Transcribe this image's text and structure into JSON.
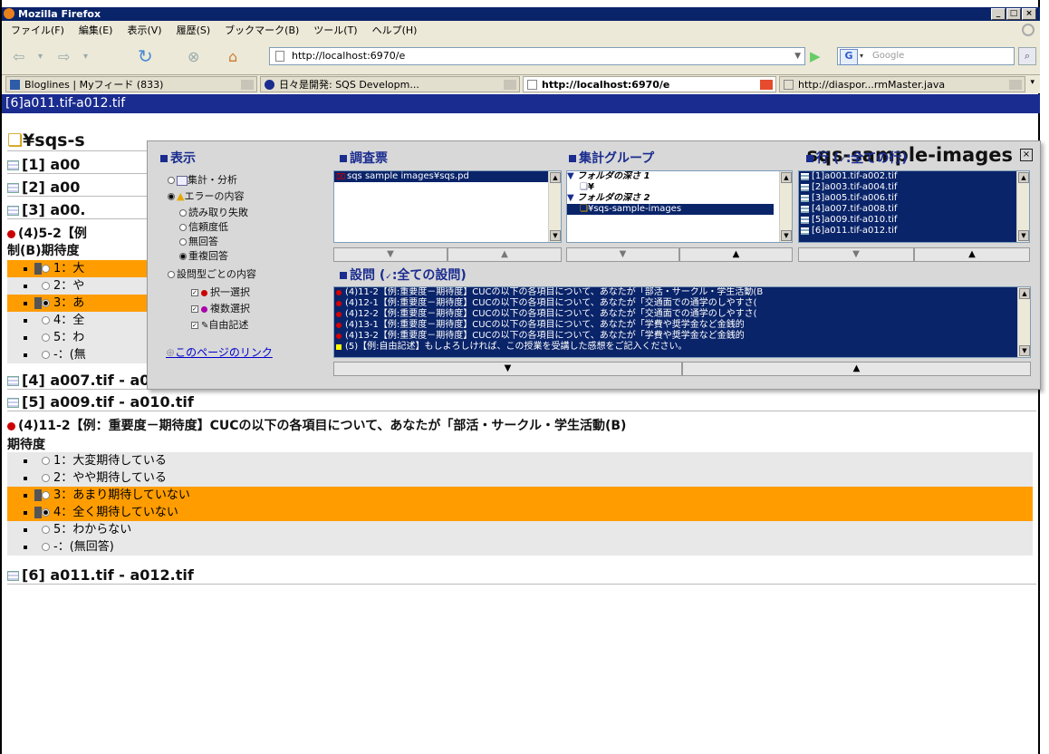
{
  "window": {
    "title": "Mozilla Firefox",
    "min": "_",
    "max": "□",
    "close": "×"
  },
  "menu": [
    "ファイル(F)",
    "編集(E)",
    "表示(V)",
    "履歴(S)",
    "ブックマーク(B)",
    "ツール(T)",
    "ヘルプ(H)"
  ],
  "nav": {
    "url": "http://localhost:6970/e",
    "search_placeholder": "Google"
  },
  "tabs": [
    {
      "label": "Bloglines | Myフィード (833)"
    },
    {
      "label": "日々是開発: SQS Developm..."
    },
    {
      "label": "http://localhost:6970/e"
    },
    {
      "label": "http://diaspor...rmMaster.java"
    }
  ],
  "page_header": "[6]a011.tif-a012.tif",
  "content": {
    "folder_title": "¥sqs-s",
    "sections": [
      "[1] a00",
      "[2] a00",
      "[3] a00.",
      "[4] a007.tif - a008.tif",
      "[5] a009.tif - a010.tif",
      "[6] a011.tif - a012.tif"
    ],
    "q_short": "(4)5-2【例",
    "q_short2": "制(B)期待度",
    "small_answers": [
      "1：大",
      "2：や",
      "3：あ",
      "4：全",
      "5：わ",
      "-：(無"
    ],
    "question": "(4)11-2【例：重要度－期待度】CUCの以下の各項目について、あなたが「部活・サークル・学生活動(B)",
    "question_cont": "期待度",
    "answers": [
      {
        "label": "1：大変期待している",
        "highlight": false
      },
      {
        "label": "2：やや期待している",
        "highlight": false
      },
      {
        "label": "3：あまり期待していない",
        "highlight": true
      },
      {
        "label": "4：全く期待していない",
        "highlight": true
      },
      {
        "label": "5：わからない",
        "highlight": false
      },
      {
        "label": "-：(無回答)",
        "highlight": false
      }
    ]
  },
  "panel": {
    "title": "sqs-sample-images",
    "display": {
      "heading": "表示",
      "opt1": "集計・分析",
      "opt2": "エラーの内容",
      "sub": [
        "読み取り失敗",
        "信頼度低",
        "無回答",
        "重複回答"
      ],
      "opt3": "設問型ごとの内容",
      "types": [
        "択一選択",
        "複数選択",
        "自由記述"
      ],
      "link": "このページのリンク"
    },
    "survey": {
      "heading": "調査票",
      "item": "sqs sample images¥sqs.pd"
    },
    "group": {
      "heading": "集計グループ",
      "items": [
        "フォルダの深さ 1",
        "¥",
        "フォルダの深さ 2",
        "¥sqs-sample-images"
      ]
    },
    "rows": {
      "heading": "行 (",
      "heading_tail": ":全ての行)",
      "items": [
        "[1]a001.tif-a002.tif",
        "[2]a003.tif-a004.tif",
        "[3]a005.tif-a006.tif",
        "[4]a007.tif-a008.tif",
        "[5]a009.tif-a010.tif",
        "[6]a011.tif-a012.tif"
      ]
    },
    "questions": {
      "heading": "設問 (",
      "heading_tail": ":全ての設問)",
      "items": [
        "(4)11-2【例:重要度－期待度】CUCの以下の各項目について、あなたが「部活・サークル・学生活動(B",
        "(4)12-1【例:重要度－期待度】CUCの以下の各項目について、あなたが「交通面での通学のしやすさ(",
        "(4)12-2【例:重要度－期待度】CUCの以下の各項目について、あなたが「交通面での通学のしやすさ(",
        "(4)13-1【例:重要度－期待度】CUCの以下の各項目について、あなたが「学費や奨学金など金銭的",
        "(4)13-2【例:重要度－期待度】CUCの以下の各項目について、あなたが「学費や奨学金など金銭的",
        "(5)【例:自由記述】もしよろしければ、この授業を受講した感想をご記入ください。"
      ]
    }
  }
}
